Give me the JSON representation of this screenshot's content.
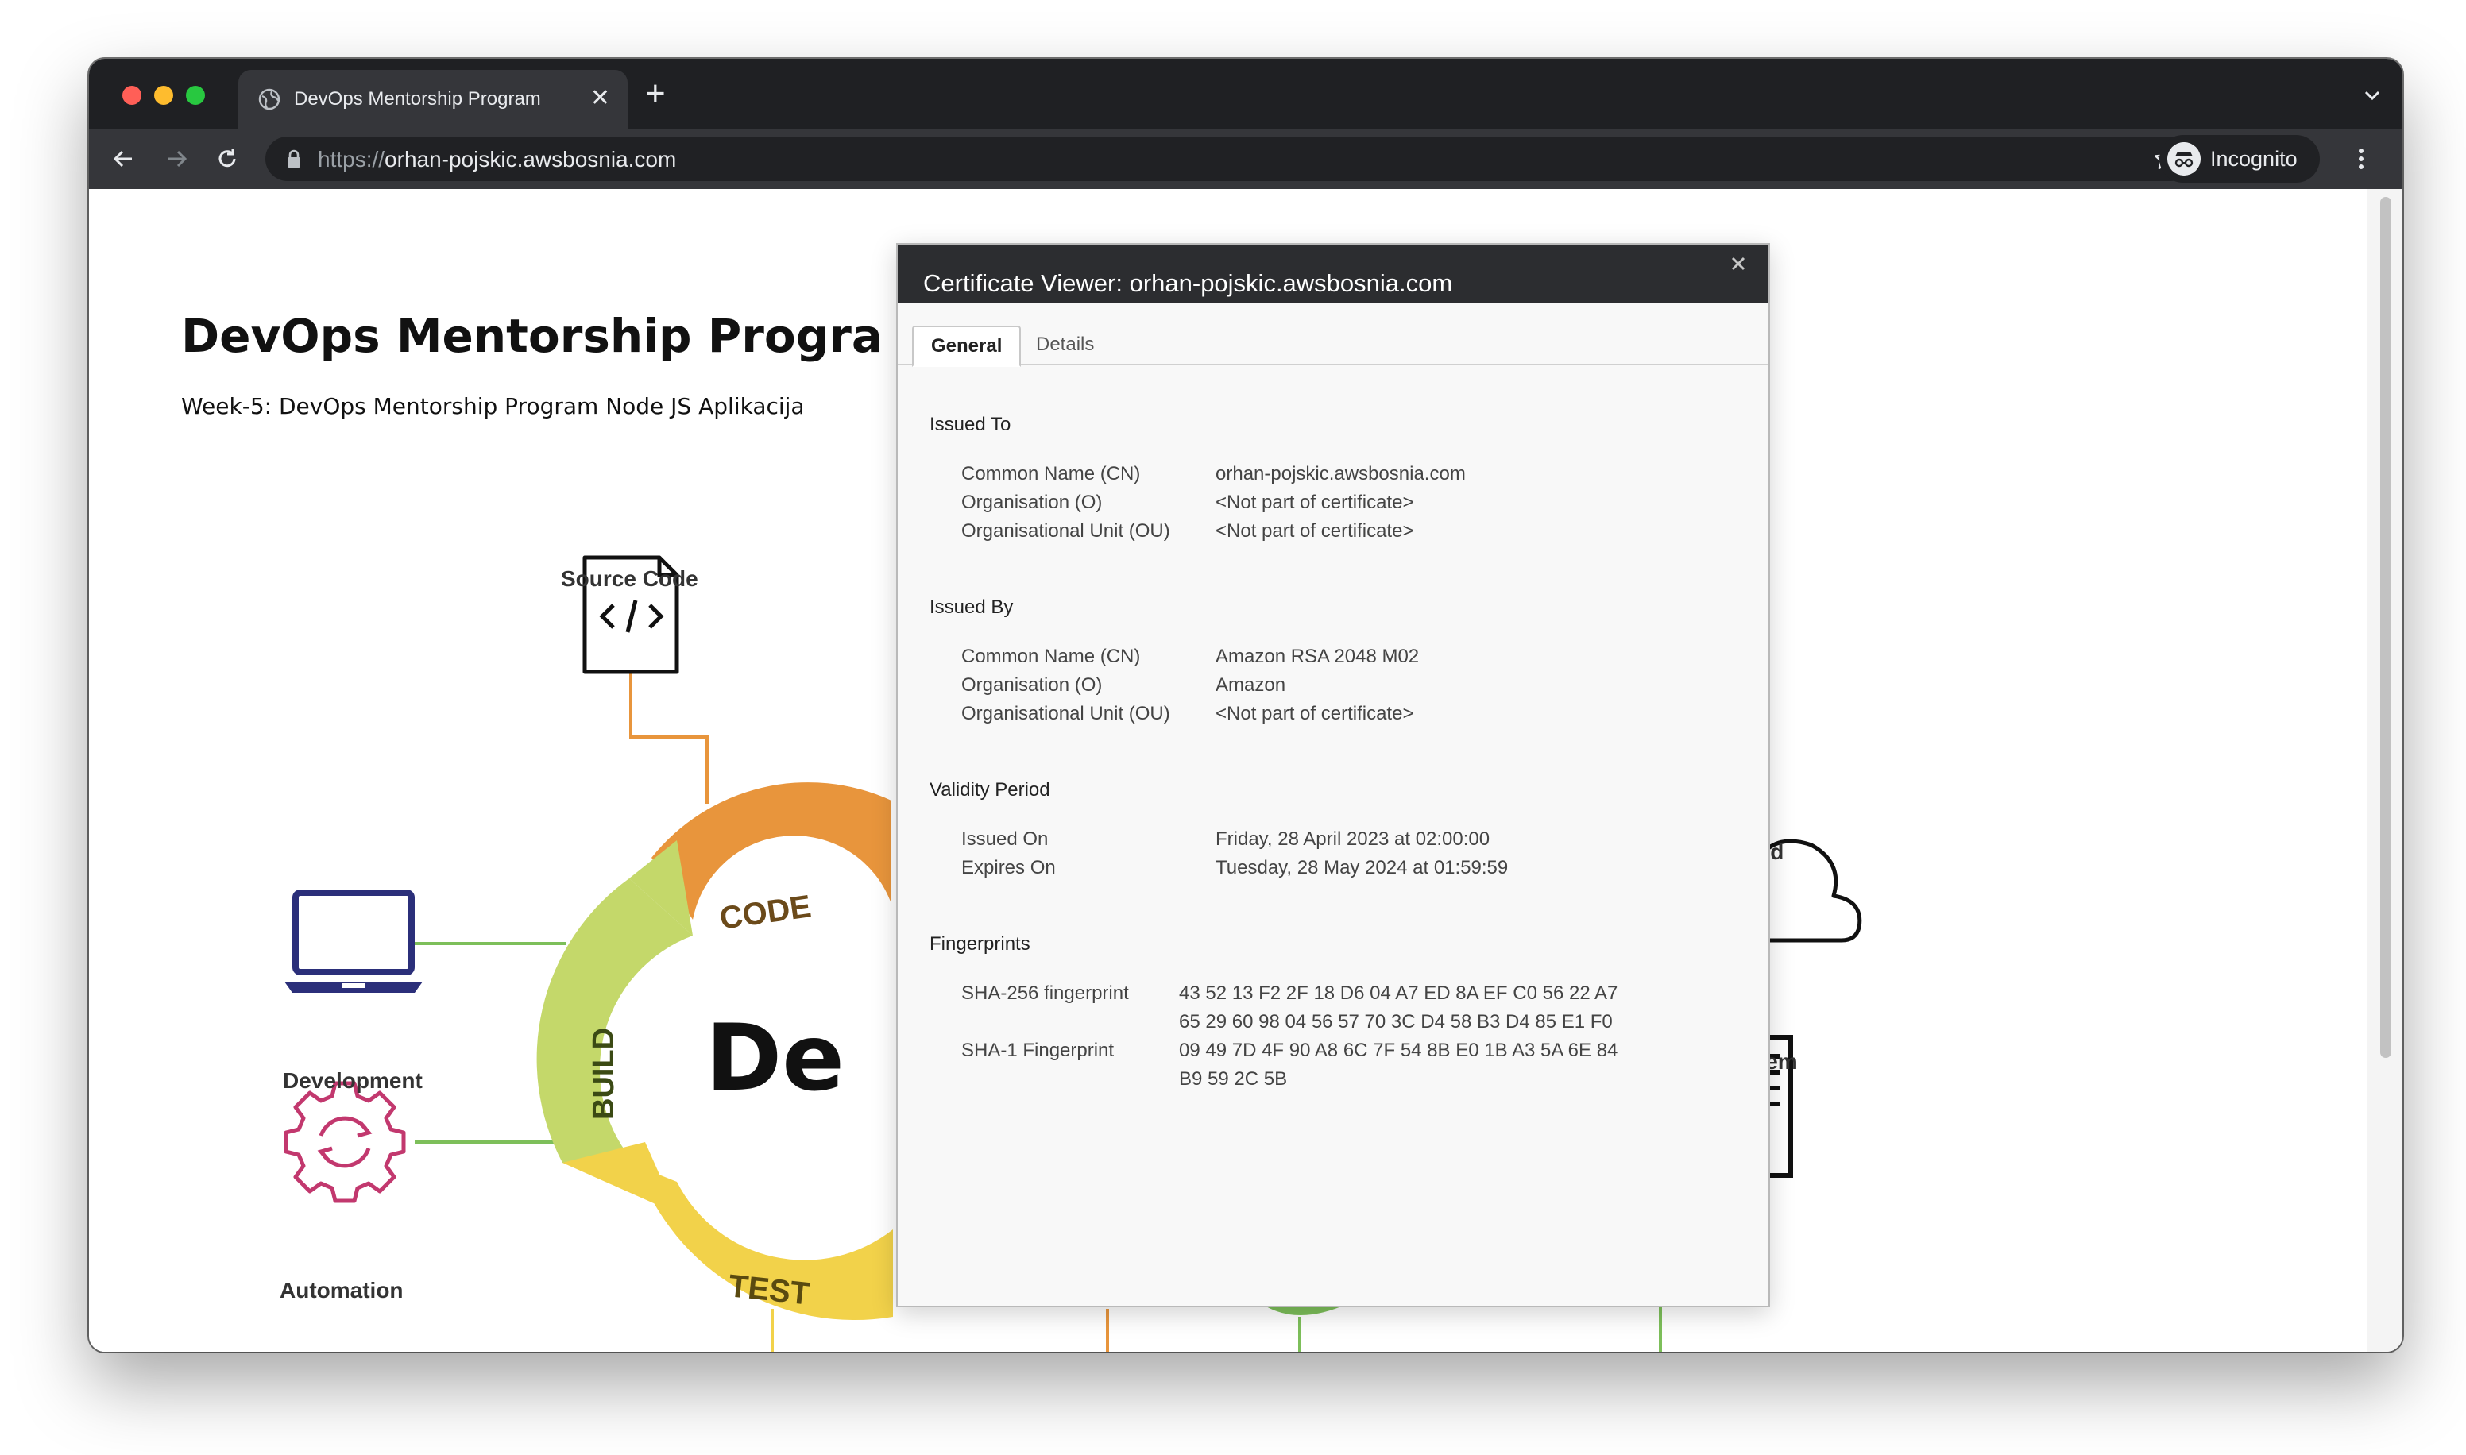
{
  "browser": {
    "tab_title": "DevOps Mentorship Program",
    "tab_close_glyph": "✕",
    "new_tab_glyph": "+",
    "url_scheme": "https://",
    "url_host": "orhan-pojskic.awsbosnia.com",
    "profile_label": "Incognito"
  },
  "page": {
    "title": "DevOps Mentorship Progra",
    "subtitle": "Week-5: DevOps Mentorship Program Node JS Aplikacija"
  },
  "diagram": {
    "source_code_label": "Source Code",
    "development_label": "Development",
    "automation_label": "Automation",
    "cloud_label": "Cloud",
    "on_prem_label": "On Prem",
    "center_text": "De",
    "ring_code": "CODE",
    "ring_build": "BUILD",
    "ring_test": "TEST",
    "colors": {
      "orange": "#e8953c",
      "green": "#7dbf5a",
      "yellow": "#f2d24a",
      "lime": "#c4d86a",
      "navy": "#2b2f7a",
      "magenta": "#c2386e"
    }
  },
  "certificate_viewer": {
    "title": "Certificate Viewer: orhan-pojskic.awsbosnia.com",
    "tabs": {
      "general": "General",
      "details": "Details"
    },
    "issued_to": {
      "heading": "Issued To",
      "rows": [
        {
          "key": "Common Name (CN)",
          "value": "orhan-pojskic.awsbosnia.com"
        },
        {
          "key": "Organisation (O)",
          "value": "<Not part of certificate>"
        },
        {
          "key": "Organisational Unit (OU)",
          "value": "<Not part of certificate>"
        }
      ]
    },
    "issued_by": {
      "heading": "Issued By",
      "rows": [
        {
          "key": "Common Name (CN)",
          "value": "Amazon RSA 2048 M02"
        },
        {
          "key": "Organisation (O)",
          "value": "Amazon"
        },
        {
          "key": "Organisational Unit (OU)",
          "value": "<Not part of certificate>"
        }
      ]
    },
    "validity": {
      "heading": "Validity Period",
      "rows": [
        {
          "key": "Issued On",
          "value": "Friday, 28 April 2023 at 02:00:00"
        },
        {
          "key": "Expires On",
          "value": "Tuesday, 28 May 2024 at 01:59:59"
        }
      ]
    },
    "fingerprints": {
      "heading": "Fingerprints",
      "sha256_key": "SHA-256 fingerprint",
      "sha256_line1": "43 52 13 F2 2F 18 D6 04 A7 ED 8A EF C0 56 22 A7",
      "sha256_line2": "65 29 60 98 04 56 57 70 3C D4 58 B3 D4 85 E1 F0",
      "sha1_key": "SHA-1 Fingerprint",
      "sha1_line1": "09 49 7D 4F 90 A8 6C 7F 54 8B E0 1B A3 5A 6E 84",
      "sha1_line2": "B9 59 2C 5B"
    }
  }
}
